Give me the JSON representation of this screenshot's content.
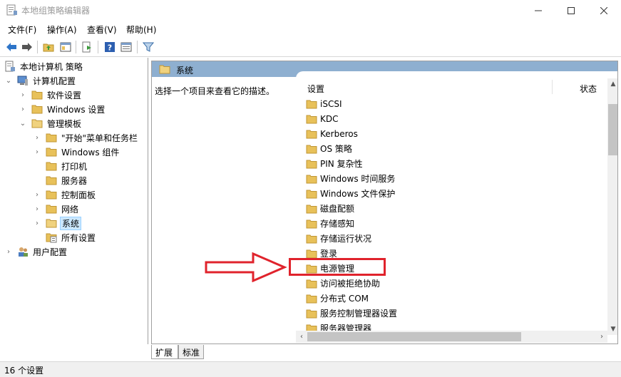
{
  "window": {
    "title": "本地组策略编辑器"
  },
  "menubar": {
    "items": [
      "文件(F)",
      "操作(A)",
      "查看(V)",
      "帮助(H)"
    ]
  },
  "toolbar": {
    "buttons": [
      "back-icon",
      "forward-icon",
      "up-folder-icon",
      "show-hide-tree-icon",
      "export-list-icon",
      "help-icon",
      "properties-icon",
      "filter-icon"
    ]
  },
  "tree": {
    "root": "本地计算机 策略",
    "computer_config": "计算机配置",
    "software_settings": "软件设置",
    "windows_settings": "Windows 设置",
    "admin_templates": "管理模板",
    "start_menu": "\"开始\"菜单和任务栏",
    "windows_components": "Windows 组件",
    "printers": "打印机",
    "servers": "服务器",
    "control_panel": "控制面板",
    "network": "网络",
    "system": "系统",
    "all_settings": "所有设置",
    "user_config": "用户配置"
  },
  "pane": {
    "header": "系统",
    "description": "选择一个项目来查看它的描述。",
    "col_setting": "设置",
    "col_state": "状态",
    "items": [
      "iSCSI",
      "KDC",
      "Kerberos",
      "OS 策略",
      "PIN 复杂性",
      "Windows 时间服务",
      "Windows 文件保护",
      "磁盘配额",
      "存储感知",
      "存储运行状况",
      "登录",
      "电源管理",
      "访问被拒绝协助",
      "分布式 COM",
      "服务控制管理器设置",
      "服务器管理器"
    ]
  },
  "tabs": {
    "extended": "扩展",
    "standard": "标准"
  },
  "status": {
    "text": "16 个设置"
  },
  "colors": {
    "header_blue": "#8eafd0",
    "highlight_red": "#e0232c",
    "folder_yellow": "#e8c15a",
    "selection": "#cce8ff"
  }
}
